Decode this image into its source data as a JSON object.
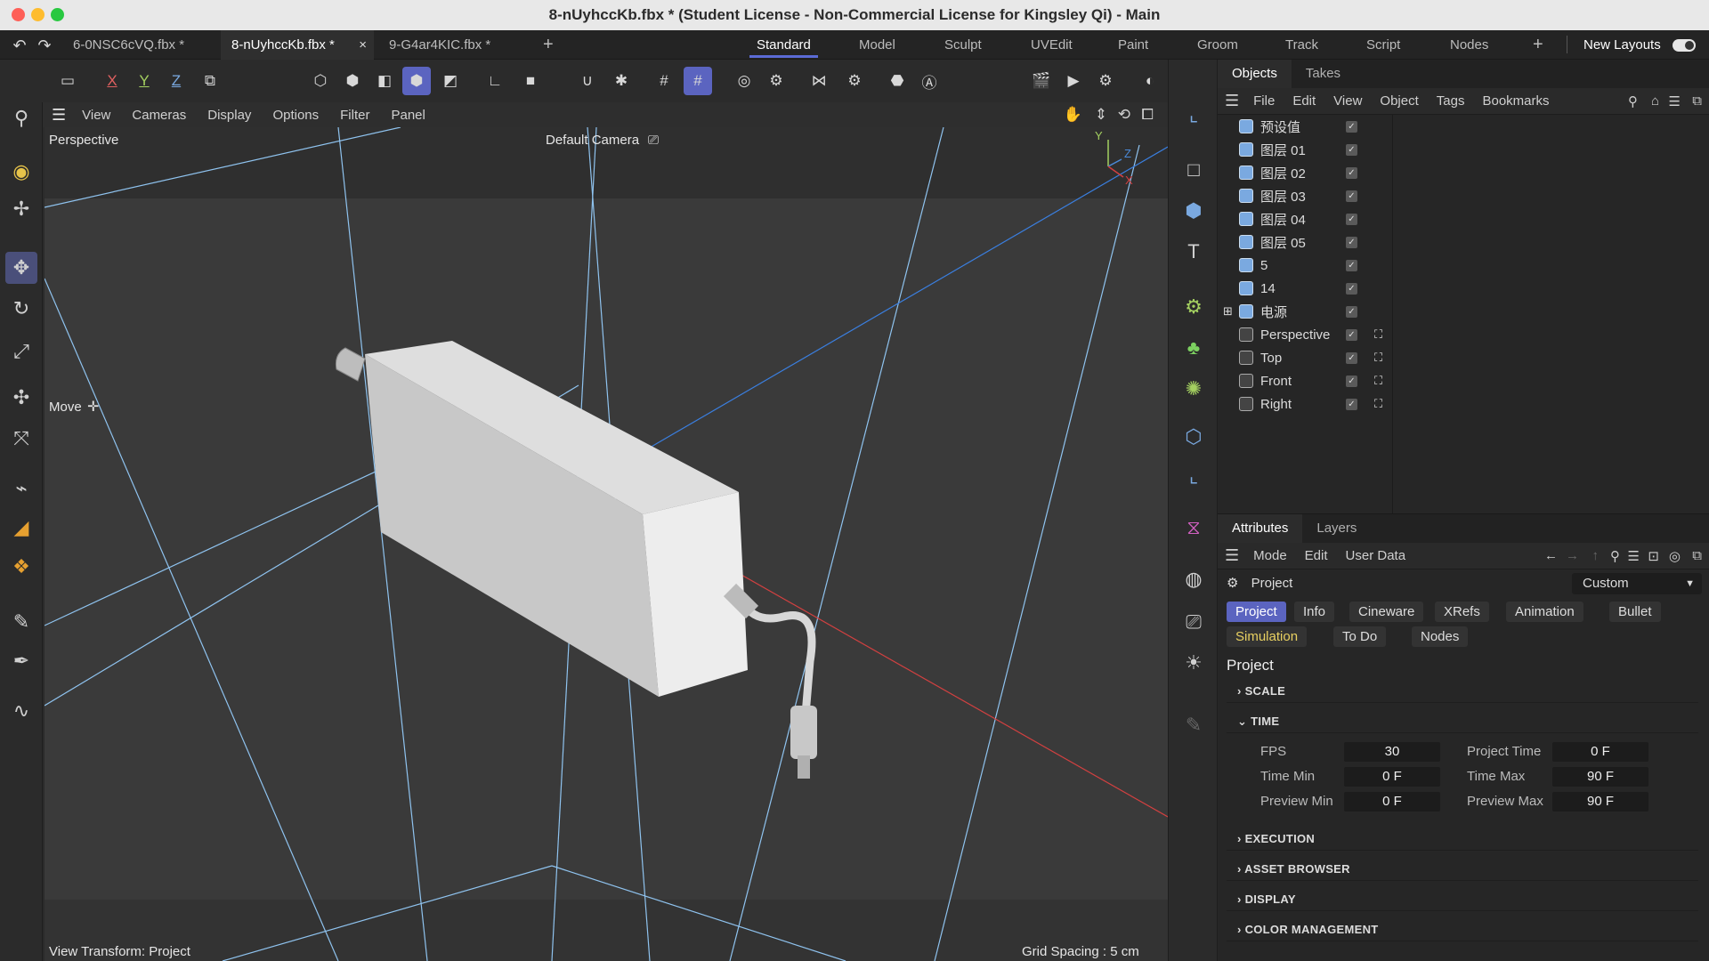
{
  "window": {
    "title": "8-nUyhccKb.fbx * (Student License - Non-Commercial License for Kingsley Qi) - Main"
  },
  "file_tabs": [
    {
      "label": "6-0NSC6cVQ.fbx *"
    },
    {
      "label": "8-nUyhccKb.fbx *"
    },
    {
      "label": "9-G4ar4KIC.fbx *"
    }
  ],
  "layout_tabs": [
    {
      "label": "Standard"
    },
    {
      "label": "Model"
    },
    {
      "label": "Sculpt"
    },
    {
      "label": "UVEdit"
    },
    {
      "label": "Paint"
    },
    {
      "label": "Groom"
    },
    {
      "label": "Track"
    },
    {
      "label": "Script"
    },
    {
      "label": "Nodes"
    }
  ],
  "new_layouts_label": "New Layouts",
  "axis_labels": {
    "x": "X",
    "y": "Y",
    "z": "Z"
  },
  "viewport_menu": [
    "View",
    "Cameras",
    "Display",
    "Options",
    "Filter",
    "Panel"
  ],
  "viewport": {
    "name": "Perspective",
    "camera": "Default Camera",
    "tool": "Move",
    "view_transform": "View Transform: Project",
    "grid_spacing": "Grid Spacing : 5 cm",
    "gizmo": {
      "y": "Y",
      "z": "Z",
      "x": "X"
    }
  },
  "objects_panel": {
    "tabs": [
      "Objects",
      "Takes"
    ],
    "menu": [
      "File",
      "Edit",
      "View",
      "Object",
      "Tags",
      "Bookmarks"
    ],
    "items": [
      {
        "label": "预设值"
      },
      {
        "label": "图层 01"
      },
      {
        "label": "图层 02"
      },
      {
        "label": "图层 03"
      },
      {
        "label": "图层 04"
      },
      {
        "label": "图层 05"
      },
      {
        "label": "5"
      },
      {
        "label": "14"
      },
      {
        "label": "电源"
      },
      {
        "label": "Perspective"
      },
      {
        "label": "Top"
      },
      {
        "label": "Front"
      },
      {
        "label": "Right"
      }
    ]
  },
  "attributes_panel": {
    "tabs": [
      "Attributes",
      "Layers"
    ],
    "menu": [
      "Mode",
      "Edit",
      "User Data"
    ],
    "object_label": "Project",
    "preset_value": "Custom",
    "buttons_row1": [
      "Project",
      "Info",
      "Cineware",
      "XRefs",
      "Animation",
      "Bullet"
    ],
    "buttons_row2": [
      "Simulation",
      "To Do",
      "Nodes"
    ],
    "section_title": "Project",
    "sections": {
      "scale": "SCALE",
      "time": "TIME",
      "execution": "EXECUTION",
      "asset_browser": "ASSET BROWSER",
      "display": "DISPLAY",
      "color_management": "COLOR MANAGEMENT"
    },
    "fields": {
      "fps": {
        "label": "FPS",
        "value": "30"
      },
      "project_time": {
        "label": "Project Time",
        "value": "0 F"
      },
      "time_min": {
        "label": "Time Min",
        "value": "0 F"
      },
      "time_max": {
        "label": "Time Max",
        "value": "90 F"
      },
      "preview_min": {
        "label": "Preview Min",
        "value": "0 F"
      },
      "preview_max": {
        "label": "Preview Max",
        "value": "90 F"
      }
    }
  },
  "colors": {
    "accent": "#5b64c0",
    "viewport_bg": "#3a3a3a",
    "guide_line": "#8fc3ef",
    "x_axis": "#d24040"
  }
}
